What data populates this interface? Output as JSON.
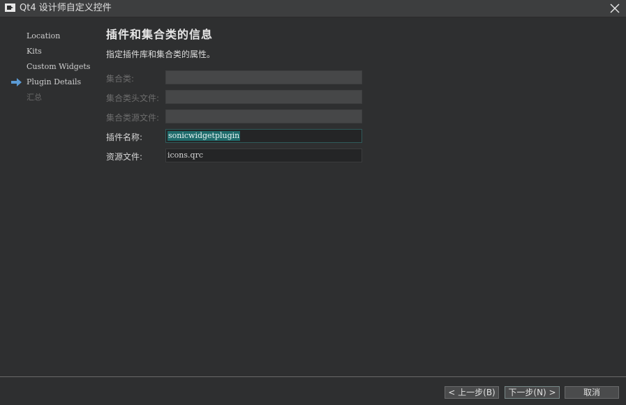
{
  "window": {
    "title": "Qt4 设计师自定义控件"
  },
  "steps": [
    {
      "label": "Location",
      "state": "done"
    },
    {
      "label": "Kits",
      "state": "done"
    },
    {
      "label": "Custom Widgets",
      "state": "done"
    },
    {
      "label": "Plugin Details",
      "state": "current"
    },
    {
      "label": "汇总",
      "state": "pending"
    }
  ],
  "page": {
    "title": "插件和集合类的信息",
    "subtitle": "指定插件库和集合类的属性。"
  },
  "form": {
    "collection_class": {
      "label": "集合类:",
      "value": "",
      "enabled": false
    },
    "collection_header": {
      "label": "集合类头文件:",
      "value": "",
      "enabled": false
    },
    "collection_source": {
      "label": "集合类源文件:",
      "value": "",
      "enabled": false
    },
    "plugin_name": {
      "label": "插件名称:",
      "value": "sonicwidgetplugin",
      "enabled": true
    },
    "resource_file": {
      "label": "资源文件:",
      "value": "icons.qrc",
      "enabled": true
    }
  },
  "buttons": {
    "back": "< 上一步(B)",
    "next": "下一步(N) >",
    "cancel": "取消"
  },
  "colors": {
    "background": "#2e2f30",
    "accent": "#5b9bd5",
    "selection": "#1f6b6b"
  }
}
